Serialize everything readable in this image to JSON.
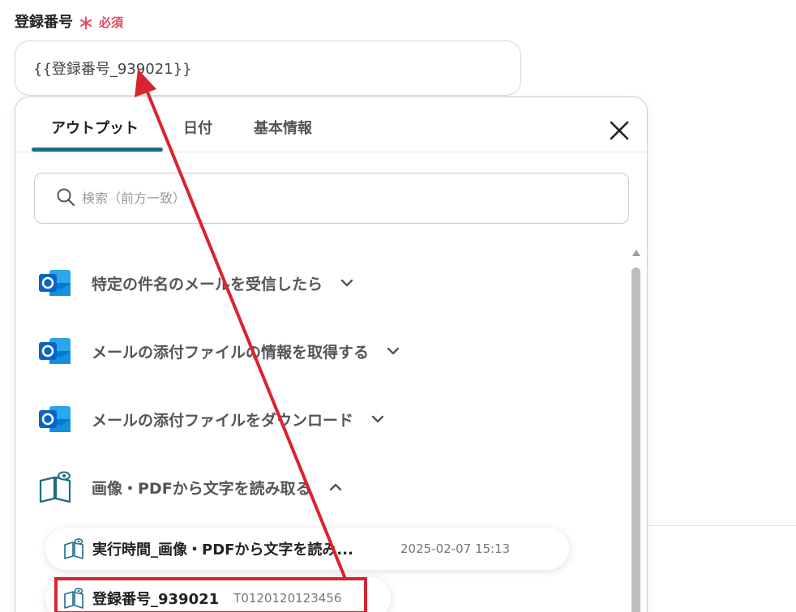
{
  "field": {
    "label": "登録番号",
    "required_mark": "＊",
    "required_text": "必須",
    "value": "{{登録番号_939021}}"
  },
  "panel": {
    "tabs": [
      {
        "label": "アウトプット",
        "active": true
      },
      {
        "label": "日付",
        "active": false
      },
      {
        "label": "基本情報",
        "active": false
      }
    ],
    "search_placeholder": "検索（前方一致）",
    "groups": [
      {
        "label": "特定の件名のメールを受信したら",
        "icon": "outlook-icon",
        "expanded": false
      },
      {
        "label": "メールの添付ファイルの情報を取得する",
        "icon": "outlook-icon",
        "expanded": false
      },
      {
        "label": "メールの添付ファイルをダウンロード",
        "icon": "outlook-icon",
        "expanded": false
      },
      {
        "label": "画像・PDFから文字を読み取る",
        "icon": "ocr-book-icon",
        "expanded": true
      }
    ],
    "items": [
      {
        "name": "実行時間_画像・PDFから文字を読み...",
        "value": "2025-02-07 15:13",
        "icon": "ocr-book-icon"
      },
      {
        "name": "登録番号_939021",
        "value": "T0120120123456",
        "icon": "ocr-book-icon"
      }
    ]
  },
  "colors": {
    "accent": "#1d6b84",
    "required": "#e5485d",
    "annotation": "#d8242f",
    "outlook_blue": "#0a64c8"
  }
}
